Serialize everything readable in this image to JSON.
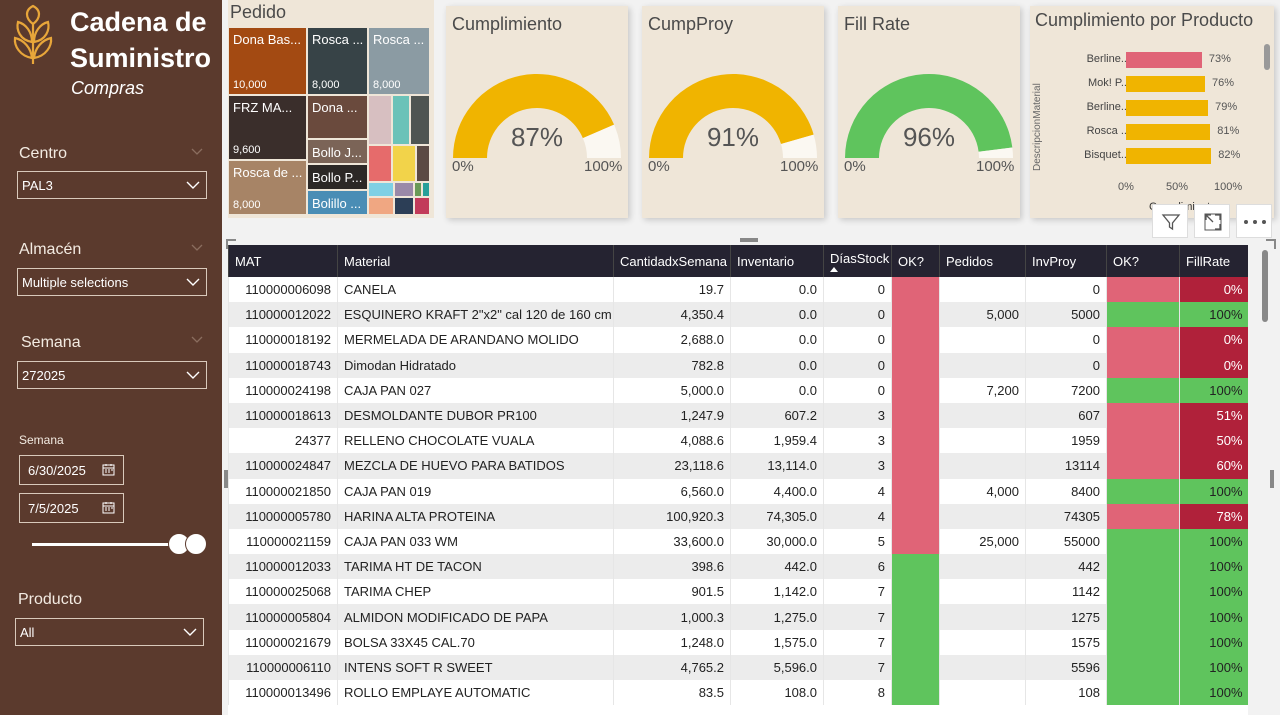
{
  "sidebar": {
    "title_line1": "Cadena de",
    "title_line2": "Suministro",
    "subtitle": "Compras",
    "centro_label": "Centro",
    "centro_value": "PAL3",
    "almacen_label": "Almacén",
    "almacen_value": "Multiple selections",
    "semana_label": "Semana",
    "semana_value": "272025",
    "semana_range_label": "Semana",
    "date_start": "6/30/2025",
    "date_end": "7/5/2025",
    "producto_label": "Producto",
    "producto_value": "All"
  },
  "treemap": {
    "title": "Pedido",
    "tiles": [
      {
        "label": "Dona Bas...",
        "value": "10,000",
        "color": "#a34a12"
      },
      {
        "label": "Rosca ...",
        "value": "8,000",
        "color": "#374347"
      },
      {
        "label": "Rosca ...",
        "value": "8,000",
        "color": "#8b9ba3"
      },
      {
        "label": "FRZ MA...",
        "value": "9,600",
        "color": "#3a2e2b"
      },
      {
        "label": "Dona ...",
        "value": "",
        "color": "#6a4a3d"
      },
      {
        "label": "Rosca de ...",
        "value": "8,000",
        "color": "#a78466"
      },
      {
        "label": "Bollo J...",
        "value": "",
        "color": "#7b6457"
      },
      {
        "label": "Bollo P...",
        "value": "",
        "color": "#2c2826"
      },
      {
        "label": "Bolillo ...",
        "value": "",
        "color": "#4a8db5"
      }
    ]
  },
  "gauges": [
    {
      "title": "Cumplimiento",
      "value": "87%",
      "fraction": 0.87,
      "min": "0%",
      "max": "100%",
      "color": "#f0b400"
    },
    {
      "title": "CumpProy",
      "value": "91%",
      "fraction": 0.91,
      "min": "0%",
      "max": "100%",
      "color": "#f0b400"
    },
    {
      "title": "Fill Rate",
      "value": "96%",
      "fraction": 0.96,
      "min": "0%",
      "max": "100%",
      "color": "#5fc45d"
    }
  ],
  "product_chart": {
    "title": "Cumplimiento por Producto",
    "ylabel": "DescripcionMaterial",
    "xlabel": "Cumplimiento",
    "ticks": [
      "0%",
      "50%",
      "100%"
    ],
    "bars": [
      {
        "label": "Berline...",
        "value": 0.73,
        "text": "73%",
        "color": "#e06477"
      },
      {
        "label": "Mok! P...",
        "value": 0.76,
        "text": "76%",
        "color": "#f0b400"
      },
      {
        "label": "Berline...",
        "value": 0.79,
        "text": "79%",
        "color": "#f0b400"
      },
      {
        "label": "Rosca ...",
        "value": 0.81,
        "text": "81%",
        "color": "#f0b400"
      },
      {
        "label": "Bisquet...",
        "value": 0.82,
        "text": "82%",
        "color": "#f0b400"
      }
    ]
  },
  "table": {
    "headers": [
      "MAT",
      "Material",
      "CantidadxSemana",
      "Inventario",
      "DíasStock",
      "OK?",
      "Pedidos",
      "InvProy",
      "OK?",
      "FillRate"
    ],
    "rows": [
      {
        "mat": "110000006098",
        "material": "CANELA",
        "cant": "19.7",
        "inv": "0.0",
        "dias": "0",
        "ok1": "red",
        "pedidos": "",
        "invproy": "0",
        "ok2": "red",
        "fill": "0%",
        "fillc": "red"
      },
      {
        "mat": "110000012022",
        "material": "ESQUINERO KRAFT 2\"x2\" cal 120 de 160 cm",
        "cant": "4,350.4",
        "inv": "0.0",
        "dias": "0",
        "ok1": "red",
        "pedidos": "5,000",
        "invproy": "5000",
        "ok2": "green",
        "fill": "100%",
        "fillc": "green"
      },
      {
        "mat": "110000018192",
        "material": "MERMELADA DE ARANDANO MOLIDO",
        "cant": "2,688.0",
        "inv": "0.0",
        "dias": "0",
        "ok1": "red",
        "pedidos": "",
        "invproy": "0",
        "ok2": "red",
        "fill": "0%",
        "fillc": "red"
      },
      {
        "mat": "110000018743",
        "material": "Dimodan Hidratado",
        "cant": "782.8",
        "inv": "0.0",
        "dias": "0",
        "ok1": "red",
        "pedidos": "",
        "invproy": "0",
        "ok2": "red",
        "fill": "0%",
        "fillc": "red"
      },
      {
        "mat": "110000024198",
        "material": "CAJA PAN 027",
        "cant": "5,000.0",
        "inv": "0.0",
        "dias": "0",
        "ok1": "red",
        "pedidos": "7,200",
        "invproy": "7200",
        "ok2": "green",
        "fill": "100%",
        "fillc": "green"
      },
      {
        "mat": "110000018613",
        "material": "DESMOLDANTE DUBOR PR100",
        "cant": "1,247.9",
        "inv": "607.2",
        "dias": "3",
        "ok1": "red",
        "pedidos": "",
        "invproy": "607",
        "ok2": "red",
        "fill": "51%",
        "fillc": "red"
      },
      {
        "mat": "24377",
        "material": "RELLENO CHOCOLATE VUALA",
        "cant": "4,088.6",
        "inv": "1,959.4",
        "dias": "3",
        "ok1": "red",
        "pedidos": "",
        "invproy": "1959",
        "ok2": "red",
        "fill": "50%",
        "fillc": "red"
      },
      {
        "mat": "110000024847",
        "material": "MEZCLA DE HUEVO PARA BATIDOS",
        "cant": "23,118.6",
        "inv": "13,114.0",
        "dias": "3",
        "ok1": "red",
        "pedidos": "",
        "invproy": "13114",
        "ok2": "red",
        "fill": "60%",
        "fillc": "red"
      },
      {
        "mat": "110000021850",
        "material": "CAJA PAN 019",
        "cant": "6,560.0",
        "inv": "4,400.0",
        "dias": "4",
        "ok1": "red",
        "pedidos": "4,000",
        "invproy": "8400",
        "ok2": "green",
        "fill": "100%",
        "fillc": "green"
      },
      {
        "mat": "110000005780",
        "material": "HARINA ALTA PROTEINA",
        "cant": "100,920.3",
        "inv": "74,305.0",
        "dias": "4",
        "ok1": "red",
        "pedidos": "",
        "invproy": "74305",
        "ok2": "red",
        "fill": "78%",
        "fillc": "red"
      },
      {
        "mat": "110000021159",
        "material": "CAJA PAN 033 WM",
        "cant": "33,600.0",
        "inv": "30,000.0",
        "dias": "5",
        "ok1": "red",
        "pedidos": "25,000",
        "invproy": "55000",
        "ok2": "green",
        "fill": "100%",
        "fillc": "green"
      },
      {
        "mat": "110000012033",
        "material": "TARIMA HT DE TACON",
        "cant": "398.6",
        "inv": "442.0",
        "dias": "6",
        "ok1": "green",
        "pedidos": "",
        "invproy": "442",
        "ok2": "green",
        "fill": "100%",
        "fillc": "green"
      },
      {
        "mat": "110000025068",
        "material": "TARIMA CHEP",
        "cant": "901.5",
        "inv": "1,142.0",
        "dias": "7",
        "ok1": "green",
        "pedidos": "",
        "invproy": "1142",
        "ok2": "green",
        "fill": "100%",
        "fillc": "green"
      },
      {
        "mat": "110000005804",
        "material": "ALMIDON MODIFICADO DE PAPA",
        "cant": "1,000.3",
        "inv": "1,275.0",
        "dias": "7",
        "ok1": "green",
        "pedidos": "",
        "invproy": "1275",
        "ok2": "green",
        "fill": "100%",
        "fillc": "green"
      },
      {
        "mat": "110000021679",
        "material": "BOLSA 33X45 CAL.70",
        "cant": "1,248.0",
        "inv": "1,575.0",
        "dias": "7",
        "ok1": "green",
        "pedidos": "",
        "invproy": "1575",
        "ok2": "green",
        "fill": "100%",
        "fillc": "green"
      },
      {
        "mat": "110000006110",
        "material": "INTENS SOFT R SWEET",
        "cant": "4,765.2",
        "inv": "5,596.0",
        "dias": "7",
        "ok1": "green",
        "pedidos": "",
        "invproy": "5596",
        "ok2": "green",
        "fill": "100%",
        "fillc": "green"
      },
      {
        "mat": "110000013496",
        "material": "ROLLO EMPLAYE AUTOMATIC",
        "cant": "83.5",
        "inv": "108.0",
        "dias": "8",
        "ok1": "green",
        "pedidos": "",
        "invproy": "108",
        "ok2": "green",
        "fill": "100%",
        "fillc": "green"
      }
    ]
  }
}
